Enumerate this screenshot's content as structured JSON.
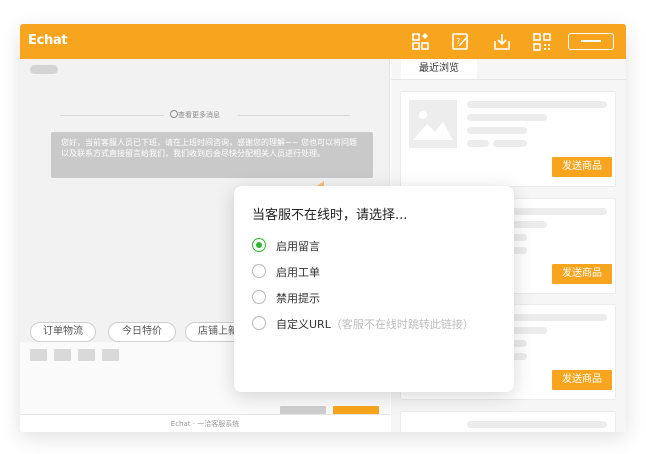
{
  "app": {
    "logo": "Echat"
  },
  "toolbar": {
    "icons": [
      "apps-icon",
      "edit-icon",
      "download-icon",
      "qrcode-icon",
      "menu-icon"
    ]
  },
  "chat": {
    "history_link": "查看更多消息",
    "notice": "您好，当前客服人员已下班，请在上班时间咨询，感谢您的理解~~ 您也可以将问题以及联系方式直接留言给我们，我们收到后会尽快分配相关人员进行处理。",
    "chips": [
      "订单物流",
      "今日特价",
      "店铺上新"
    ],
    "footer": "Echat · 一洽客服系统"
  },
  "side": {
    "tab": "最近浏览",
    "send_label": "发送商品"
  },
  "popup": {
    "title": "当客服不在线时，请选择...",
    "options": [
      {
        "label": "启用留言",
        "selected": true
      },
      {
        "label": "启用工单",
        "selected": false
      },
      {
        "label": "禁用提示",
        "selected": false
      },
      {
        "label": "自定义URL",
        "hint": "（客服不在线时跳转此链接）",
        "selected": false
      }
    ]
  },
  "colors": {
    "accent": "#f7a51e",
    "radio_on": "#2fb52f"
  }
}
